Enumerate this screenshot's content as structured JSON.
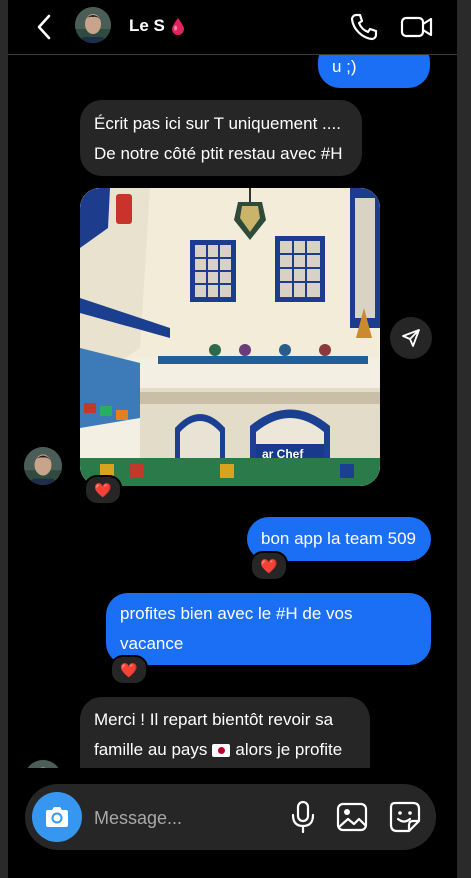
{
  "header": {
    "contact_name": "Le S",
    "name_emoji": "drop-emoji",
    "icons": [
      "back-chevron-icon",
      "phone-icon",
      "video-camera-icon"
    ]
  },
  "messages": [
    {
      "direction": "outgoing",
      "text": "u ;)"
    },
    {
      "direction": "incoming",
      "text": "Écrit pas ici sur T uniquement ....\nDe notre côté ptit restau avec #H"
    },
    {
      "direction": "incoming",
      "type": "photo",
      "reaction": "❤️"
    },
    {
      "direction": "outgoing",
      "text": "bon app la team 509",
      "reaction": "❤️"
    },
    {
      "direction": "outgoing",
      "text": "profites bien avec le #H de vos\nvacance",
      "reaction": "❤️"
    },
    {
      "direction": "incoming",
      "text_line1": "Merci ! Il repart bientôt revoir sa",
      "text_line2_a": "famille au pays",
      "text_line2_flag": "🇯🇵",
      "text_line2_b": "alors je profite"
    }
  ],
  "photo_sign_text": "ar Chef",
  "composer": {
    "placeholder": "Message...",
    "icons": [
      "camera-icon",
      "microphone-icon",
      "gallery-icon",
      "sticker-icon"
    ]
  },
  "colors": {
    "outgoing_bubble": "#1b6ff5",
    "incoming_bubble": "#262626",
    "background": "#000000",
    "camera_button": "#3797f0",
    "drop_emoji": "#e0245e"
  }
}
